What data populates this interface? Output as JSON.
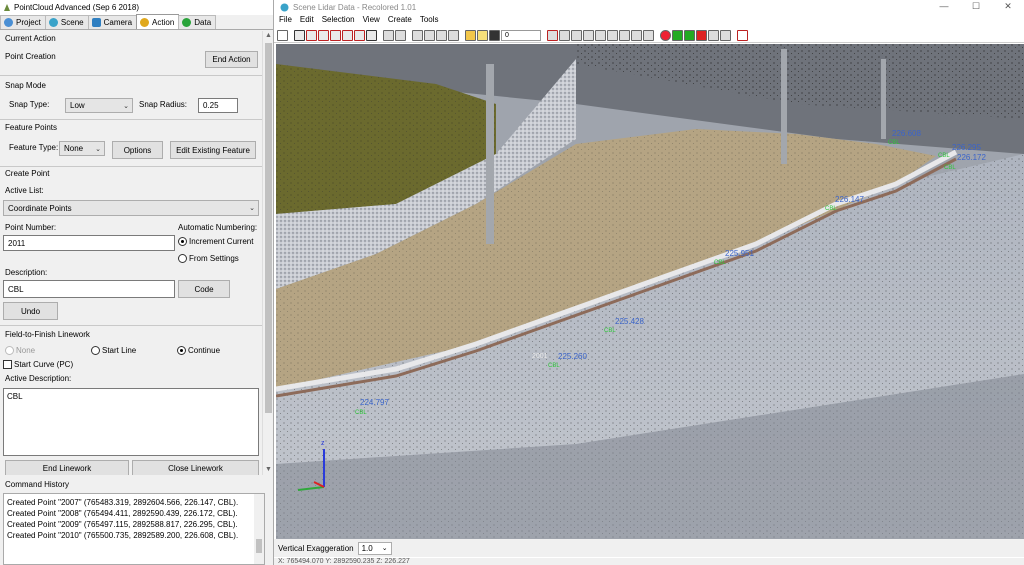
{
  "left_window": {
    "title": "PointCloud Advanced (Sep  6 2018)",
    "tabs": [
      {
        "label": "Project",
        "icon": "project-icon",
        "active": false
      },
      {
        "label": "Scene",
        "icon": "scene-icon",
        "active": false
      },
      {
        "label": "Camera",
        "icon": "camera-icon",
        "active": false
      },
      {
        "label": "Action",
        "icon": "action-icon",
        "active": true
      },
      {
        "label": "Data",
        "icon": "data-icon",
        "active": false
      }
    ],
    "current_action": {
      "title": "Current Action",
      "value": "Point Creation",
      "end_button": "End Action"
    },
    "snap_mode": {
      "title": "Snap Mode",
      "type_label": "Snap Type:",
      "type_value": "Low",
      "radius_label": "Snap Radius:",
      "radius_value": "0.25"
    },
    "feature_points": {
      "title": "Feature Points",
      "type_label": "Feature Type:",
      "type_value": "None",
      "options_button": "Options",
      "edit_button": "Edit Existing Feature"
    },
    "create_point": {
      "title": "Create Point",
      "active_list_label": "Active List:",
      "active_list_value": "Coordinate Points",
      "point_number_label": "Point Number:",
      "point_number_value": "2011",
      "auto_numbering_label": "Automatic Numbering:",
      "increment_current": "Increment Current",
      "from_settings": "From Settings",
      "description_label": "Description:",
      "description_value": "CBL",
      "code_button": "Code",
      "undo_button": "Undo"
    },
    "linework": {
      "title": "Field-to-Finish Linework",
      "none": "None",
      "start_line": "Start Line",
      "continue": "Continue",
      "start_curve": "Start Curve (PC)",
      "active_description_label": "Active Description:",
      "active_description_value": "CBL",
      "end_linework_button": "End Linework",
      "close_linework_button": "Close Linework"
    },
    "command_history": {
      "title": "Command History",
      "lines": [
        "Created Point \"2007\" (765483.319, 2892604.566, 226.147, CBL).",
        "Created Point \"2008\" (765494.411, 2892590.439, 226.172, CBL).",
        "Created Point \"2009\" (765497.115, 2892588.817, 226.295, CBL).",
        "Created Point \"2010\" (765500.735, 2892589.200, 226.608, CBL)."
      ]
    }
  },
  "right_window": {
    "title": "Scene Lidar Data - Recolored 1.01",
    "menu": [
      "File",
      "Edit",
      "Selection",
      "View",
      "Create",
      "Tools"
    ],
    "toolbar_combo_value": "0",
    "elevation_labels": [
      {
        "text": "226.608",
        "code": "CBL"
      },
      {
        "text": "226.295",
        "code": "CBL"
      },
      {
        "text": "226.172",
        "code": "CBL"
      },
      {
        "text": "226.147",
        "code": "CBL"
      },
      {
        "text": "225.951",
        "code": "CBL"
      },
      {
        "text": "225.428",
        "code": "CBL"
      },
      {
        "text": "225.260",
        "code": "CBL"
      },
      {
        "text": "224.797",
        "code": "CBL"
      }
    ],
    "point_number_label": "2001",
    "vertical_exaggeration_label": "Vertical Exaggeration",
    "vertical_exaggeration_value": "1.0",
    "coord_readout": "X: 765494.070     Y: 2892590.235     Z: 226.227"
  },
  "colors": {
    "elevation_text": "#3b64c9",
    "code_text": "#2fc53a",
    "panel_bg": "#f0f0f0"
  }
}
